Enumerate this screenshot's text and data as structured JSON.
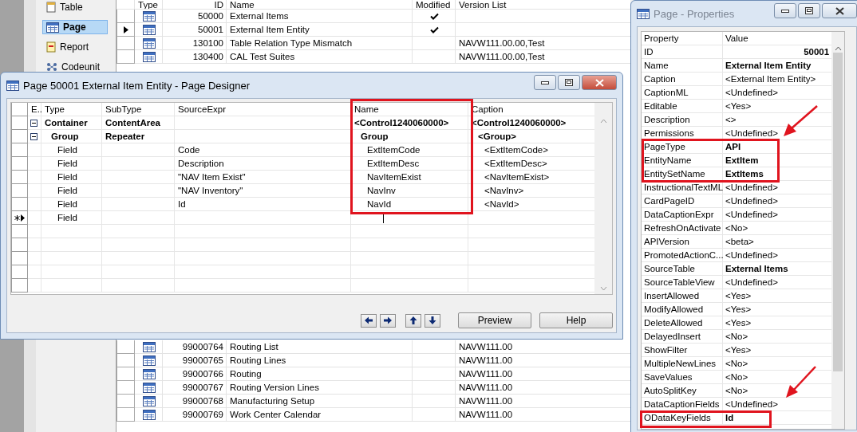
{
  "navigation": {
    "items": [
      {
        "label": "Table",
        "selected": false,
        "kind": "table"
      },
      {
        "label": "Page",
        "selected": true,
        "kind": "page"
      },
      {
        "label": "Report",
        "selected": false,
        "kind": "report"
      },
      {
        "label": "Codeunit",
        "selected": false,
        "kind": "codeunit"
      }
    ]
  },
  "object_list": {
    "columns": [
      "Type",
      "ID",
      "Name",
      "Modified",
      "Version List"
    ],
    "rows_top": [
      {
        "id": "50000",
        "name": "External Items",
        "modified": true,
        "selected": false
      },
      {
        "id": "50001",
        "name": "External Item Entity",
        "modified": true,
        "selected": true
      },
      {
        "id": "130100",
        "name": "Table Relation Type Mismatch",
        "modified": false,
        "version": "NAVW111.00.00,Test",
        "selected": false
      },
      {
        "id": "130400",
        "name": "CAL Test Suites",
        "modified": false,
        "version": "NAVW111.00.00,Test",
        "selected": false
      }
    ],
    "rows_bottom": [
      {
        "id": "99000764",
        "name": "Routing List",
        "modified": false,
        "version": "NAVW111.00",
        "selected": false
      },
      {
        "id": "99000765",
        "name": "Routing Lines",
        "modified": false,
        "version": "NAVW111.00",
        "selected": false
      },
      {
        "id": "99000766",
        "name": "Routing",
        "modified": false,
        "version": "NAVW111.00",
        "selected": false
      },
      {
        "id": "99000767",
        "name": "Routing Version Lines",
        "modified": false,
        "version": "NAVW111.00",
        "selected": false
      },
      {
        "id": "99000768",
        "name": "Manufacturing Setup",
        "modified": false,
        "version": "NAVW111.00",
        "selected": false
      },
      {
        "id": "99000769",
        "name": "Work Center Calendar",
        "modified": false,
        "version": "NAVW111.00",
        "selected": false
      }
    ]
  },
  "designer": {
    "title": "Page 50001 External Item Entity - Page Designer",
    "columns": [
      "E..",
      "Type",
      "SubType",
      "SourceExpr",
      "Name",
      "Caption"
    ],
    "controls": [
      {
        "kind": "container",
        "type": "Container",
        "subtype": "ContentArea",
        "name": "<Control1240060000>",
        "caption": "<Control1240060000>",
        "expanded": true,
        "children": [
          {
            "kind": "group",
            "type": "Group",
            "subtype": "Repeater",
            "name": "Group",
            "caption": "<Group>",
            "expanded": true,
            "children": [
              {
                "kind": "field",
                "type": "Field",
                "source_expr": "Code",
                "name": "ExtItemCode",
                "caption": "<ExtItemCode>"
              },
              {
                "kind": "field",
                "type": "Field",
                "source_expr": "Description",
                "name": "ExtItemDesc",
                "caption": "<ExtItemDesc>"
              },
              {
                "kind": "field",
                "type": "Field",
                "source_expr": "\"NAV Item Exist\"",
                "name": "NavItemExist",
                "caption": "<NavItemExist>"
              },
              {
                "kind": "field",
                "type": "Field",
                "source_expr": "\"NAV Inventory\"",
                "name": "NavInv",
                "caption": "<NavInv>"
              },
              {
                "kind": "field",
                "type": "Field",
                "source_expr": "Id",
                "name": "NavId",
                "caption": "<NavId>"
              },
              {
                "kind": "new",
                "type": "Field"
              }
            ]
          }
        ]
      }
    ],
    "buttons": [
      "Preview",
      "Help"
    ]
  },
  "properties": {
    "title": "Page - Properties",
    "columns": [
      "Property",
      "Value"
    ],
    "rows": [
      {
        "property": "ID",
        "value": "50001",
        "bold": true,
        "kind": "number"
      },
      {
        "property": "Name",
        "value": "External Item Entity",
        "bold": true,
        "kind": "text"
      },
      {
        "property": "Caption",
        "value": "<External Item Entity>",
        "bold": false,
        "kind": "text"
      },
      {
        "property": "CaptionML",
        "value": "<Undefined>",
        "bold": false,
        "kind": "text"
      },
      {
        "property": "Editable",
        "value": "<Yes>",
        "bold": false,
        "kind": "text"
      },
      {
        "property": "Description",
        "value": "<>",
        "bold": false,
        "kind": "text"
      },
      {
        "property": "Permissions",
        "value": "<Undefined>",
        "bold": false,
        "kind": "text"
      },
      {
        "property": "PageType",
        "value": "API",
        "bold": true,
        "kind": "text"
      },
      {
        "property": "EntityName",
        "value": "ExtItem",
        "bold": true,
        "kind": "text"
      },
      {
        "property": "EntitySetName",
        "value": "ExtItems",
        "bold": true,
        "kind": "text"
      },
      {
        "property": "InstructionalTextML",
        "value": "<Undefined>",
        "bold": false,
        "kind": "text"
      },
      {
        "property": "CardPageID",
        "value": "<Undefined>",
        "bold": false,
        "kind": "text"
      },
      {
        "property": "DataCaptionExpr",
        "value": "<Undefined>",
        "bold": false,
        "kind": "text"
      },
      {
        "property": "RefreshOnActivate",
        "value": "<No>",
        "bold": false,
        "kind": "text"
      },
      {
        "property": "APIVersion",
        "value": "<beta>",
        "bold": false,
        "kind": "text"
      },
      {
        "property": "PromotedActionC...",
        "value": "<Undefined>",
        "bold": false,
        "kind": "text"
      },
      {
        "property": "SourceTable",
        "value": "External Items",
        "bold": true,
        "kind": "text"
      },
      {
        "property": "SourceTableView",
        "value": "<Undefined>",
        "bold": false,
        "kind": "text"
      },
      {
        "property": "InsertAllowed",
        "value": "<Yes>",
        "bold": false,
        "kind": "text"
      },
      {
        "property": "ModifyAllowed",
        "value": "<Yes>",
        "bold": false,
        "kind": "text"
      },
      {
        "property": "DeleteAllowed",
        "value": "<Yes>",
        "bold": false,
        "kind": "text"
      },
      {
        "property": "DelayedInsert",
        "value": "<No>",
        "bold": false,
        "kind": "text"
      },
      {
        "property": "ShowFilter",
        "value": "<Yes>",
        "bold": false,
        "kind": "text"
      },
      {
        "property": "MultipleNewLines",
        "value": "<No>",
        "bold": false,
        "kind": "text"
      },
      {
        "property": "SaveValues",
        "value": "<No>",
        "bold": false,
        "kind": "text"
      },
      {
        "property": "AutoSplitKey",
        "value": "<No>",
        "bold": false,
        "kind": "text"
      },
      {
        "property": "DataCaptionFields",
        "value": "<Undefined>",
        "bold": false,
        "kind": "text"
      },
      {
        "property": "ODataKeyFields",
        "value": "Id",
        "bold": true,
        "kind": "text"
      }
    ]
  }
}
